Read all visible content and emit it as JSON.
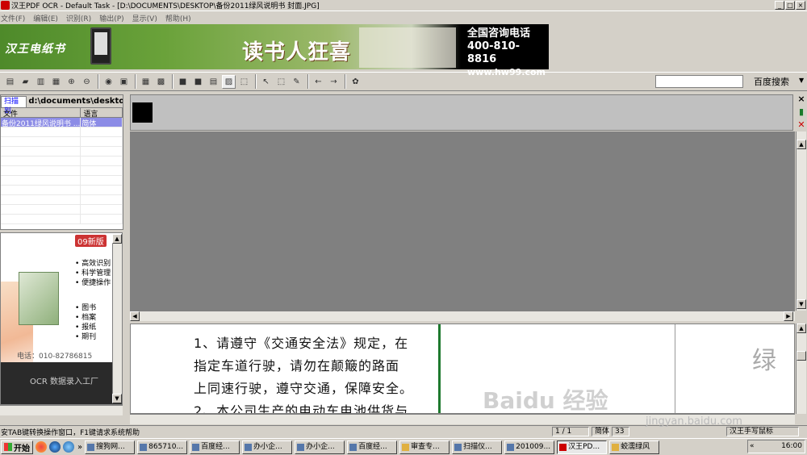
{
  "window": {
    "title": "汉王PDF OCR - Default Task - [D:\\DOCUMENTS\\DESKTOP\\备份2011绿风说明书 封面.JPG]"
  },
  "menu": [
    "文件(F)",
    "编辑(E)",
    "识别(R)",
    "输出(P)",
    "显示(V)",
    "帮助(H)"
  ],
  "banner": {
    "logo": "汉王电纸书",
    "slogan": "读书人狂喜",
    "contact_title": "全国咨询电话",
    "phone": "400-810-8816",
    "url": "www.hw99.com"
  },
  "search": {
    "button": "百度搜索"
  },
  "filepane": {
    "tab": "扫描到",
    "path": "d:\\documents\\desktop\\",
    "columns": [
      "文件",
      "语言"
    ],
    "rows": [
      {
        "file": "备份2011绿风说明书 ...",
        "lang": "简体"
      }
    ]
  },
  "leftad": {
    "badge": "09新版",
    "features1": [
      "高效识别",
      "科学管理",
      "便捷操作"
    ],
    "features2": [
      "图书",
      "档案",
      "报纸",
      "期刊"
    ],
    "tel": "电话：010-82786815",
    "ocr": "OCR 数据录入工厂"
  },
  "document": {
    "lines": [
      "1、请遵守《交通安全法》规定，在",
      "指定车道行驶，请勿在颠簸的路面",
      "上同速行驶，遵守交通，保障安全。",
      "2、本公司生产的电动车电池供货与"
    ],
    "watermark_char": "绿"
  },
  "overlay": {
    "baidu": "Baidu 经验",
    "baidu_url": "jingyan.baidu.com"
  },
  "status": {
    "message": "安TAB键转换操作窗口，F1键请求系统帮助",
    "page": "1 / 1",
    "lang": "简体",
    "count": "33",
    "hint": "汉王手写鼠标"
  },
  "taskbar": {
    "start": "开始",
    "tasks": [
      "搜狗网...",
      "865710...",
      "百度经...",
      "办小企...",
      "办小企...",
      "百度经...",
      "审查专...",
      "扫描仪...",
      "201009...",
      "汉王PD...",
      "蛟濡绿风"
    ],
    "clock": "16:00"
  }
}
